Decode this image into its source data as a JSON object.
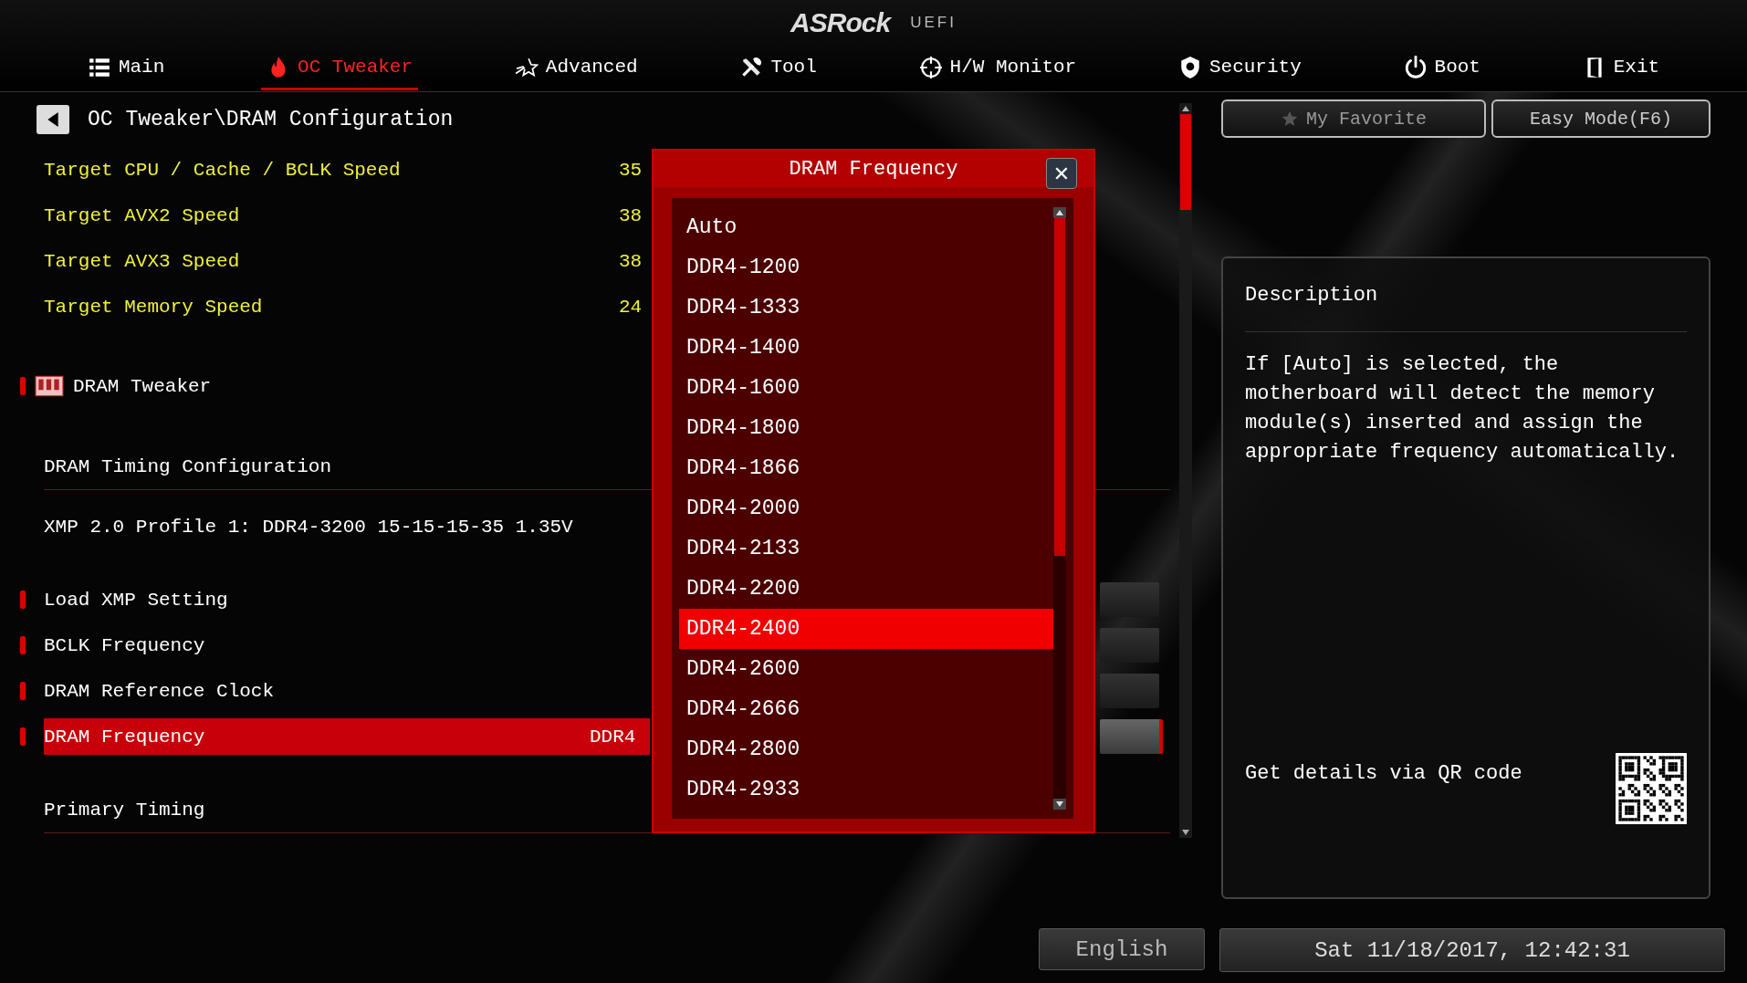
{
  "header": {
    "logo": "ASRock",
    "logo_suffix": "UEFI"
  },
  "tabs": [
    {
      "label": "Main",
      "selected": false
    },
    {
      "label": "OC Tweaker",
      "selected": true
    },
    {
      "label": "Advanced",
      "selected": false
    },
    {
      "label": "Tool",
      "selected": false
    },
    {
      "label": "H/W Monitor",
      "selected": false
    },
    {
      "label": "Security",
      "selected": false
    },
    {
      "label": "Boot",
      "selected": false
    },
    {
      "label": "Exit",
      "selected": false
    }
  ],
  "breadcrumb": "OC Tweaker\\DRAM Configuration",
  "top_buttons": [
    "My Favorite",
    "Easy Mode(F6)"
  ],
  "rows": [
    {
      "kind": "info",
      "label": "Target CPU / Cache / BCLK Speed",
      "value": "35"
    },
    {
      "kind": "info",
      "label": "Target AVX2 Speed",
      "value": "38"
    },
    {
      "kind": "info",
      "label": "Target AVX3 Speed",
      "value": "38"
    },
    {
      "kind": "info",
      "label": "Target Memory Speed",
      "value": "24"
    },
    {
      "kind": "submenu",
      "label": "DRAM Tweaker"
    },
    {
      "kind": "section",
      "label": "DRAM Timing Configuration"
    },
    {
      "kind": "text",
      "label": "XMP 2.0 Profile 1: DDR4-3200 15-15-15-35 1.35V"
    },
    {
      "kind": "setting",
      "label": "Load XMP Setting",
      "selected": false
    },
    {
      "kind": "setting",
      "label": "BCLK Frequency",
      "selected": false
    },
    {
      "kind": "setting",
      "label": "DRAM Reference Clock",
      "selected": false
    },
    {
      "kind": "setting",
      "label": "DRAM Frequency",
      "value": "DDR4",
      "selected": true
    },
    {
      "kind": "section",
      "label": "Primary Timing"
    }
  ],
  "popup": {
    "title": "DRAM Frequency",
    "close": "✕",
    "options": [
      {
        "label": "Auto",
        "selected": false
      },
      {
        "label": "DDR4-1200",
        "selected": false
      },
      {
        "label": "DDR4-1333",
        "selected": false
      },
      {
        "label": "DDR4-1400",
        "selected": false
      },
      {
        "label": "DDR4-1600",
        "selected": false
      },
      {
        "label": "DDR4-1800",
        "selected": false
      },
      {
        "label": "DDR4-1866",
        "selected": false
      },
      {
        "label": "DDR4-2000",
        "selected": false
      },
      {
        "label": "DDR4-2133",
        "selected": false
      },
      {
        "label": "DDR4-2200",
        "selected": false
      },
      {
        "label": "DDR4-2400",
        "selected": true
      },
      {
        "label": "DDR4-2600",
        "selected": false
      },
      {
        "label": "DDR4-2666",
        "selected": false
      },
      {
        "label": "DDR4-2800",
        "selected": false
      },
      {
        "label": "DDR4-2933",
        "selected": false
      }
    ]
  },
  "description": {
    "title": "Description",
    "text": "If [Auto] is selected, the motherboard will detect the memory module(s) inserted and assign the appropriate frequency automatically.",
    "qr_label": "Get details via QR code"
  },
  "footer": {
    "language": "English",
    "datetime": "Sat 11/18/2017, 12:42:31"
  }
}
